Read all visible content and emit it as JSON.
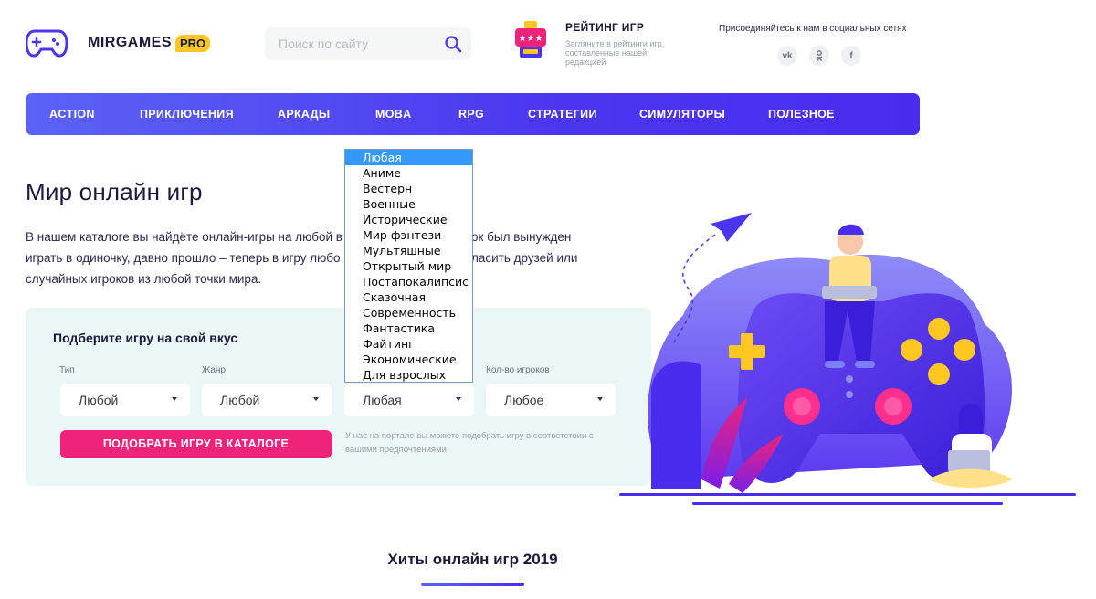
{
  "header": {
    "logo_text": "MIRGAMES",
    "logo_badge": "PRO",
    "search_placeholder": "Поиск по сайту",
    "rating_title": "РЕЙТИНГ ИГР",
    "rating_sub": "Загляните в рейтинги игр, составленные нашей редакцией",
    "social_title": "Присоединяйтесь к нам в социальных сетях",
    "social_icons": [
      "vk-icon",
      "odnoklassniki-icon",
      "facebook-icon"
    ]
  },
  "nav": {
    "items": [
      "ACTION",
      "ПРИКЛЮЧЕНИЯ",
      "АРКАДЫ",
      "MOBA",
      "RPG",
      "СТРАТЕГИИ",
      "СИМУЛЯТОРЫ",
      "ПОЛЕЗНОЕ"
    ]
  },
  "hero": {
    "title": "Мир онлайн игр",
    "intro_line1": "В нашем каталоге вы найдёте онлайн-игры на любой в",
    "intro_line1b": "ок был вынужден",
    "intro_line2": "играть в одиночку, давно прошло – теперь в игру любо",
    "intro_line2b": "ласить друзей или",
    "intro_line3": "случайных игроков из любой точки мира."
  },
  "filter": {
    "title": "Подберите игру на свой вкус",
    "labels": {
      "type": "Тип",
      "genre": "Жанр",
      "players": "Кол-во игроков"
    },
    "values": {
      "type": "Любой",
      "genre": "Любой",
      "setting": "Любая",
      "players": "Любое"
    },
    "button": "ПОДОБРАТЬ ИГРУ В КАТАЛОГЕ",
    "note": "У нас на портале вы можете подобрать игру в соответствии с вашими предпочтениями"
  },
  "dropdown": {
    "selected": "Любая",
    "options": [
      "Аниме",
      "Вестерн",
      "Военные",
      "Исторические",
      "Мир фэнтези",
      "Мультяшные",
      "Открытый мир",
      "Постапокалипсис",
      "Сказочная",
      "Современность",
      "Фантастика",
      "Файтинг",
      "Экономические",
      "Для взрослых"
    ]
  },
  "hits": {
    "title": "Хиты онлайн игр 2019"
  },
  "colors": {
    "accent": "#4b36ef",
    "pink": "#f0237a",
    "yellow": "#ffc720",
    "panel": "#eaf7f6"
  }
}
